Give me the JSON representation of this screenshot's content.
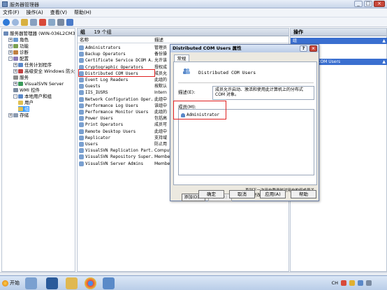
{
  "window": {
    "title": "服务器管理器",
    "buttons": [
      "_",
      "□",
      "×"
    ]
  },
  "menu": [
    "文件(F)",
    "操作(A)",
    "查看(V)",
    "帮助(H)"
  ],
  "tree": [
    {
      "label": "服务器管理器 (WIN-036L2CM3C0)",
      "indent": 0,
      "expander": "",
      "icon": "server-icon"
    },
    {
      "label": "角色",
      "indent": 1,
      "expander": "+",
      "icon": "roles-icon"
    },
    {
      "label": "功能",
      "indent": 1,
      "expander": "+",
      "icon": "features-icon"
    },
    {
      "label": "诊断",
      "indent": 1,
      "expander": "+",
      "icon": "diagnostics-icon"
    },
    {
      "label": "配置",
      "indent": 1,
      "expander": "-",
      "icon": "config-icon"
    },
    {
      "label": "任务计划程序",
      "indent": 2,
      "expander": "+",
      "icon": "task-scheduler-icon"
    },
    {
      "label": "高级安全 Windows 防火墙",
      "indent": 2,
      "expander": "+",
      "icon": "firewall-icon"
    },
    {
      "label": "服务",
      "indent": 2,
      "expander": "",
      "icon": "services-icon"
    },
    {
      "label": "VisualSVN Server",
      "indent": 2,
      "expander": "+",
      "icon": "visualsvn-icon"
    },
    {
      "label": "WMI 控件",
      "indent": 2,
      "expander": "",
      "icon": "wmi-icon"
    },
    {
      "label": "本地用户和组",
      "indent": 2,
      "expander": "-",
      "icon": "users-groups-icon"
    },
    {
      "label": "用户",
      "indent": 3,
      "expander": "",
      "icon": "folder-icon"
    },
    {
      "label": "组",
      "indent": 3,
      "expander": "",
      "icon": "folder-icon",
      "selected": true
    },
    {
      "label": "存储",
      "indent": 1,
      "expander": "+",
      "icon": "storage-icon"
    }
  ],
  "list": {
    "header": "组",
    "count": "19 个组",
    "columns": [
      "名称",
      "描述"
    ],
    "rows": [
      {
        "name": "Administrators",
        "desc": "管理员"
      },
      {
        "name": "Backup Operators",
        "desc": "备份操"
      },
      {
        "name": "Certificate Service DCOM A...",
        "desc": "允许该"
      },
      {
        "name": "Cryptographic Operators",
        "desc": "授权成"
      },
      {
        "name": "Distributed COM Users",
        "desc": "成员允"
      },
      {
        "name": "Event Log Readers",
        "desc": "此组的"
      },
      {
        "name": "Guests",
        "desc": "按默认"
      },
      {
        "name": "IIS_IUSRS",
        "desc": "Intern"
      },
      {
        "name": "Network Configuration Oper...",
        "desc": "此组中"
      },
      {
        "name": "Performance Log Users",
        "desc": "该组中"
      },
      {
        "name": "Performance Monitor Users",
        "desc": "此组的"
      },
      {
        "name": "Power Users",
        "desc": "包括高"
      },
      {
        "name": "Print Operators",
        "desc": "成员可"
      },
      {
        "name": "Remote Desktop Users",
        "desc": "此组中"
      },
      {
        "name": "Replicator",
        "desc": "支持域"
      },
      {
        "name": "Users",
        "desc": "防止用"
      },
      {
        "name": "VisualSVN Replication Part...",
        "desc": "Comput"
      },
      {
        "name": "VisualSVN Repository Super...",
        "desc": "Member"
      },
      {
        "name": "VisualSVN Server Admins",
        "desc": "Member"
      }
    ]
  },
  "actions": {
    "header": "操作",
    "band1": "组",
    "band2": "Distributed COM Users",
    "arrow": "▲"
  },
  "dialog": {
    "title": "Distributed COM Users 属性",
    "tab": "常规",
    "group_name": "Distributed COM Users",
    "desc_label": "描述(E):",
    "desc_text": "成员允许启动、激活和使用此计算机上的分布式 COM 对象。",
    "members_label": "成员(M):",
    "member": "Administrator",
    "add": "添加(D)...",
    "remove": "删除(R)",
    "note": "直到下一次用户登录时对用户的组成员关系的更改才生效。",
    "ok": "确定",
    "cancel": "取消",
    "apply": "应用(A)",
    "help": "帮助"
  },
  "taskbar": {
    "start": "开始",
    "tray_ime": "CH",
    "clock": ""
  },
  "colors": {
    "highlight": "#e02020",
    "selection": "#3399ff",
    "accent": "#3a6fd0"
  }
}
